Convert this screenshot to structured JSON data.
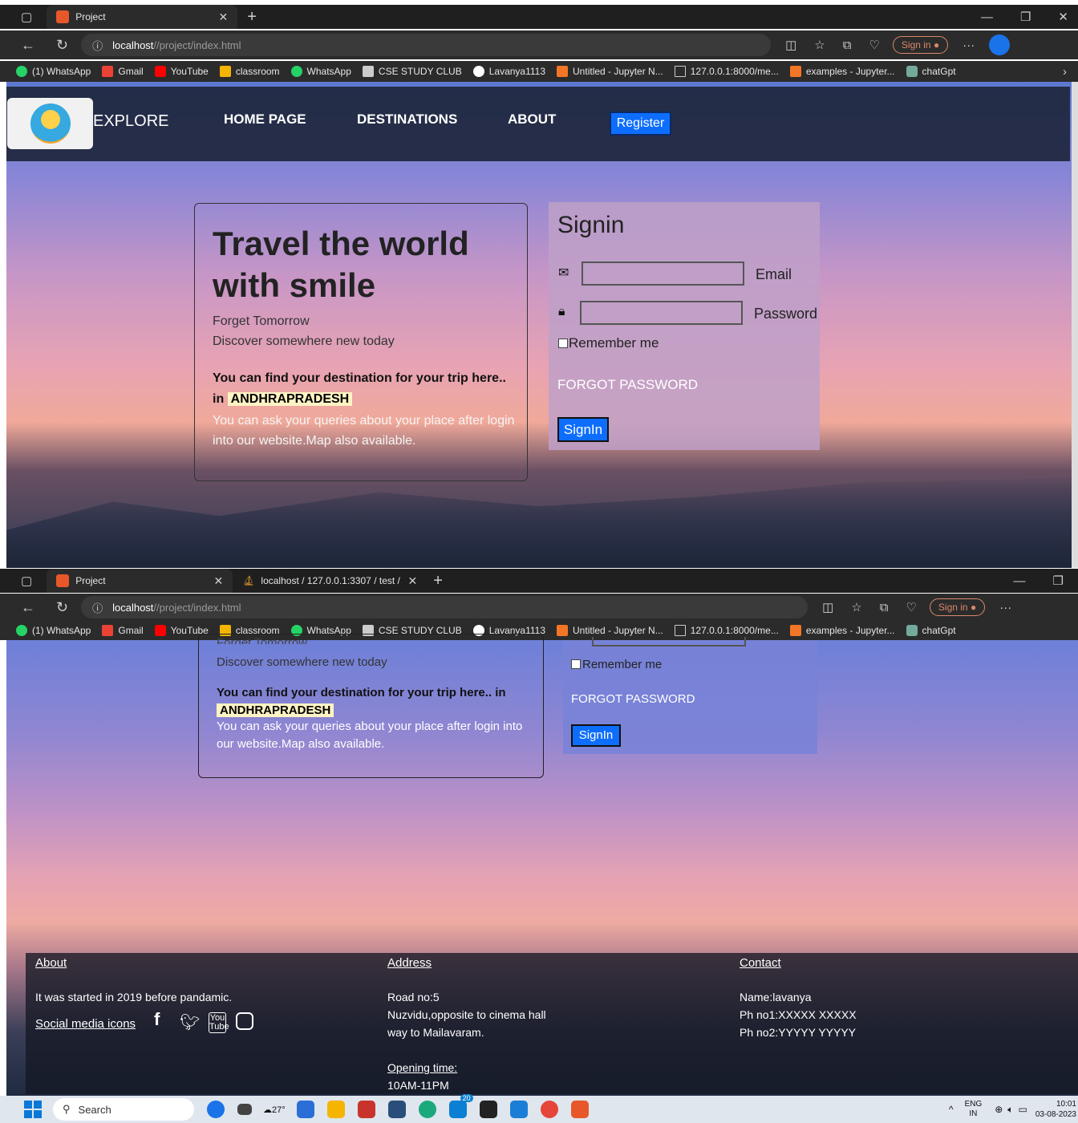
{
  "tab1": {
    "title": "Project"
  },
  "tab2": {
    "title": "localhost / 127.0.0.1:3307 / test /"
  },
  "address": {
    "host": "localhost",
    "path": "//project/index.html"
  },
  "browser": {
    "sign_in": "Sign in"
  },
  "bookmarks": [
    "(1) WhatsApp",
    "Gmail",
    "YouTube",
    "classroom",
    "WhatsApp",
    "CSE STUDY CLUB",
    "Lavanya1113",
    "Untitled - Jupyter N...",
    "127.0.0.1:8000/me...",
    "examples - Jupyter...",
    "chatGpt"
  ],
  "nav": {
    "brand": "EXPLORE",
    "home": "HOME PAGE",
    "destinations": "DESTINATIONS",
    "about": "ABOUT",
    "register": "Register"
  },
  "hero": {
    "title_line1": "Travel the world",
    "title_line2": "with smile",
    "tag1": "Forget Tomorrow",
    "tag2": "Discover somewhere new today",
    "find_text": "You can find your destination for your trip here.. in",
    "state": "ANDHRAPRADESH",
    "ask_text": "You can ask your queries about your place after login into our website.Map also available."
  },
  "signin": {
    "title": "Signin",
    "email_label": "Email",
    "password_label": "Password",
    "remember": "Remember me",
    "forgot": "FORGOT PASSWORD",
    "button": "SignIn"
  },
  "hero2": {
    "tag_partial": "Forget Tomorrow"
  },
  "footer": {
    "about_heading": "About",
    "about_text": "It was started in 2019 before pandamic.",
    "social": "Social media icons",
    "address_heading": "Address",
    "address_line1": "Road no:5",
    "address_line2": "Nuzvidu,opposite to cinema hall",
    "address_line3": "way to Mailavaram.",
    "opening_heading": "Opening time:",
    "opening_hours": "10AM-11PM",
    "contact_heading": "Contact",
    "contact_name": "Name:lavanya",
    "contact_ph1": "Ph no1:XXXXX XXXXX",
    "contact_ph2": "Ph no2:YYYYY YYYYY"
  },
  "taskbar": {
    "search": "Search",
    "weather": "27°",
    "lang1": "ENG",
    "lang2": "IN",
    "time": "10:01",
    "date": "03-08-2023",
    "badge1": "20"
  }
}
